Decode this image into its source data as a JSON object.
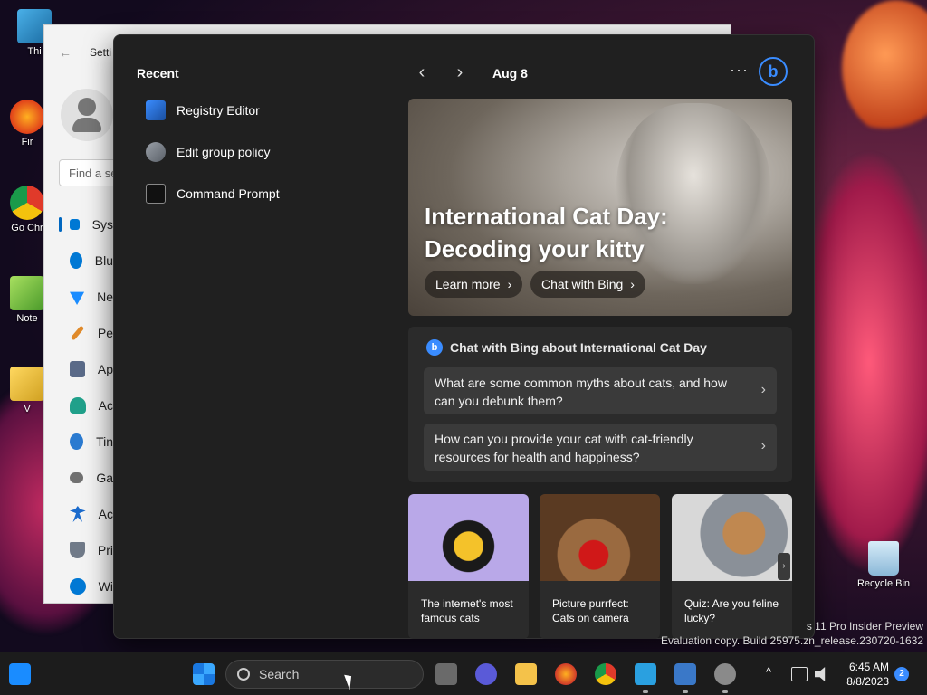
{
  "desktop": {
    "icons": [
      {
        "label": "Thi"
      },
      {
        "label": "Fir"
      },
      {
        "label": "Go Chr"
      },
      {
        "label": "Note"
      },
      {
        "label": "V"
      }
    ],
    "recycle_bin": "Recycle Bin",
    "watermark_line1": "s 11 Pro Insider Preview",
    "watermark_line2": "Evaluation copy. Build 25975.zn_release.230720-1632"
  },
  "settings": {
    "title": "Setti",
    "find_placeholder": "Find a se",
    "nav": [
      {
        "label": "Sys",
        "color": "#0078d4"
      },
      {
        "label": "Blu",
        "color": "#0078d4"
      },
      {
        "label": "Ne",
        "color": "#1a8cff"
      },
      {
        "label": "Pe",
        "color": "#e08a2a"
      },
      {
        "label": "Ap",
        "color": "#5a6a88"
      },
      {
        "label": "Ac",
        "color": "#20a08a"
      },
      {
        "label": "Tin",
        "color": "#2a7ad0"
      },
      {
        "label": "Ga",
        "color": "#707070"
      },
      {
        "label": "Ac",
        "color": "#1a6acc"
      },
      {
        "label": "Pri",
        "color": "#707a88"
      },
      {
        "label": "Wi",
        "color": "#0078d4"
      }
    ]
  },
  "flyout": {
    "recent_title": "Recent",
    "recent_items": [
      {
        "label": "Registry Editor"
      },
      {
        "label": "Edit group policy"
      },
      {
        "label": "Command Prompt"
      }
    ],
    "date": "Aug 8",
    "prev_glyph": "‹",
    "next_glyph": "›",
    "more_glyph": "···",
    "bing_glyph": "b",
    "hero": {
      "title": "International Cat Day: Decoding your kitty",
      "learn_more": "Learn more",
      "chat_bing": "Chat with Bing",
      "chevron": "›"
    },
    "chat": {
      "heading": "Chat with Bing about International Cat Day",
      "questions": [
        {
          "text": "What are some common myths about cats, and how can you debunk them?"
        },
        {
          "text": "How can you provide your cat with cat-friendly resources for health and happiness?"
        }
      ]
    },
    "tiles": [
      {
        "caption": "The internet's most famous cats"
      },
      {
        "caption": "Picture purrfect: Cats on camera"
      },
      {
        "caption": "Quiz: Are you feline lucky?"
      }
    ]
  },
  "taskbar": {
    "search_placeholder": "Search",
    "time": "6:45 AM",
    "date": "8/8/2023",
    "notifications": "2",
    "caret": "^"
  },
  "colors": {
    "accent": "#3a8cff",
    "flyout_bg": "#202020",
    "card_bg": "#2b2b2b"
  }
}
